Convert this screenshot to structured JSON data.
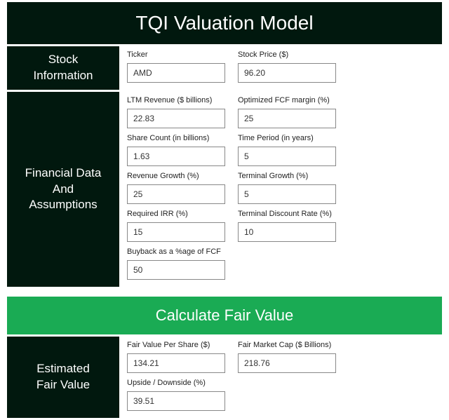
{
  "title": "TQI Valuation Model",
  "calculate_label": "Calculate Fair Value",
  "sections": {
    "stock_info": {
      "label": "Stock\nInformation",
      "fields": {
        "ticker": {
          "label": "Ticker",
          "value": "AMD"
        },
        "price": {
          "label": "Stock Price ($)",
          "value": "96.20"
        }
      }
    },
    "financial": {
      "label": "Financial Data\nAnd\nAssumptions",
      "fields": {
        "ltm_rev": {
          "label": "LTM Revenue ($ billions)",
          "value": "22.83"
        },
        "fcf_margin": {
          "label": "Optimized FCF margin (%)",
          "value": "25"
        },
        "shares": {
          "label": "Share Count (in billions)",
          "value": "1.63"
        },
        "period": {
          "label": "Time Period (in years)",
          "value": "5"
        },
        "rev_growth": {
          "label": "Revenue Growth (%)",
          "value": "25"
        },
        "term_growth": {
          "label": "Terminal Growth (%)",
          "value": "5"
        },
        "irr": {
          "label": "Required IRR (%)",
          "value": "15"
        },
        "term_disc": {
          "label": "Terminal Discount Rate (%)",
          "value": "10"
        },
        "buyback": {
          "label": "Buyback as a %age of FCF",
          "value": "50"
        }
      }
    },
    "estimated": {
      "label": "Estimated\nFair Value",
      "fields": {
        "fv_share": {
          "label": "Fair Value Per Share ($)",
          "value": "134.21"
        },
        "fv_mcap": {
          "label": "Fair Market Cap ($ Billions)",
          "value": "218.76"
        },
        "upside": {
          "label": "Upside / Downside (%)",
          "value": "39.51"
        }
      }
    }
  }
}
